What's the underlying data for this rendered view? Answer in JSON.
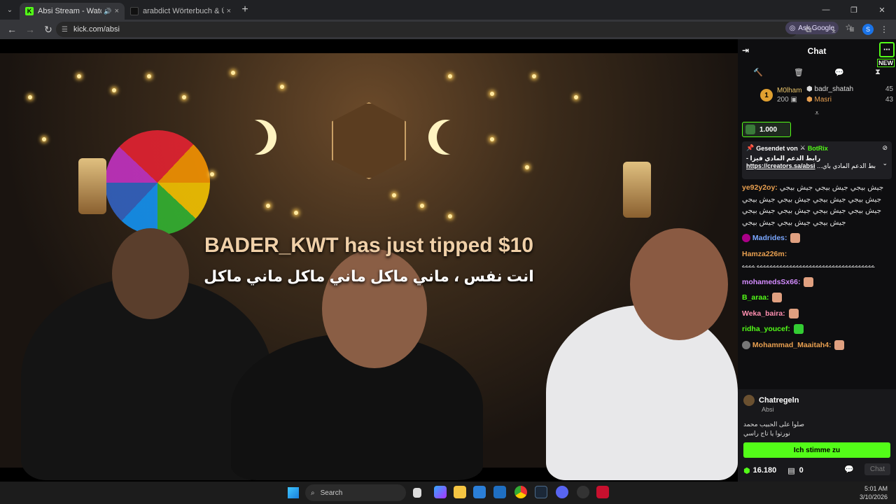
{
  "browser": {
    "tabs": [
      {
        "title": "Absi Stream - Watch Live on",
        "favicon": "kick-logo",
        "audio": true
      },
      {
        "title": "arabdict Wörterbuch & Überse",
        "favicon": "arabdict-logo"
      }
    ],
    "url": "kick.com/absi",
    "ask_google": "Ask Google"
  },
  "video": {
    "tip_text": "BADER_KWT has just tipped $10",
    "tip_message": "انت نفس ، ماني ماكل ماني ماكل ماني ماكل"
  },
  "chat": {
    "title": "Chat",
    "new_badge": "NEW",
    "top_gifter": {
      "rank": "1",
      "name": "M0lham",
      "count": "200"
    },
    "gifters": [
      {
        "name": "badr_shatah",
        "count": "45"
      },
      {
        "name": "Masri",
        "count": "43"
      }
    ],
    "kicks": "1.000",
    "pinned": {
      "sent_by_label": "Gesendet von",
      "sender": "BotRix",
      "text": "رابط الدعم المادي فيزا -",
      "link": "https://creators.sa/absi",
      "trail": "...بط الدعم المادي باي"
    },
    "messages": [
      {
        "user": "ye92y2oy:",
        "color": "#e9a050",
        "text": "جيش بيجي جيش بيجي جيش بيجي جيش بيجي جيش بيجي جيش بيجي جيش بيجي جيش بيجي جيش بيجي جيش بيجي جيش بيجي جيش بيجي جيش بيجي جيش بيجي"
      },
      {
        "user": "Madrides:",
        "color": "#7aa7ff"
      },
      {
        "user": "Hamza226m:",
        "color": "#e9a050",
        "text": "ےےےےےےےےےےےےےےےےےےےےےےےےےےےےےےےےےےےے ےےےے"
      },
      {
        "user": "mohamedsSx66:",
        "color": "#d48cff"
      },
      {
        "user": "B_araa:",
        "color": "#53fc18"
      },
      {
        "user": "Weka_baira:",
        "color": "#ff8fb0"
      },
      {
        "user": "ridha_youcef:",
        "color": "#53fc18"
      },
      {
        "user": "Mohammad_Maaitah4:",
        "color": "#e9a050"
      }
    ],
    "rules": {
      "title": "Chatregeln",
      "owner": "Absi",
      "line1": "صلوا على الحبيب محمد",
      "line2": "نورتوا يا تاج راسي",
      "agree": "Ich stimme zu"
    },
    "footer": {
      "points": "16.180",
      "drops": "0",
      "chat_btn": "Chat"
    }
  },
  "taskbar": {
    "search": "Search",
    "time": "5:01 AM",
    "date": "3/10/2026"
  },
  "colors": {
    "accent": "#53fc18",
    "chat_bg": "#0e0e10",
    "chrome_bg": "#202124"
  }
}
